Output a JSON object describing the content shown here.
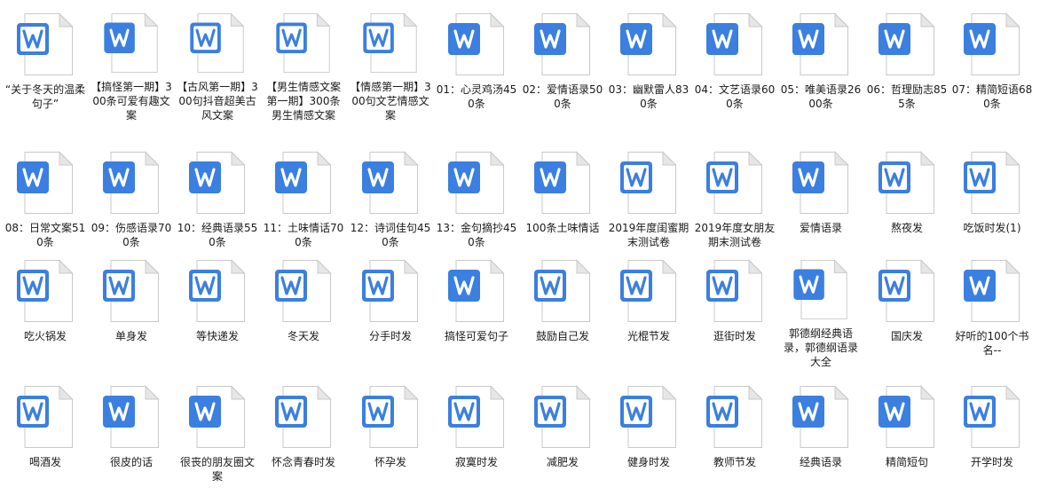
{
  "colors": {
    "word_blue": "#3B7FE0",
    "page_fill": "#FFFFFF",
    "page_border": "#C9C9C9",
    "fold_fill": "#E6E6E6",
    "label_text": "#1A1A1A"
  },
  "icons": {
    "solid": "word-document-icon",
    "outline": "word-document-outline-icon"
  },
  "rows": [
    [
      {
        "label": "“关于冬天的温柔句子”",
        "icon": "outline"
      },
      {
        "label": "【搞怪第一期】300条可爱有趣文案",
        "icon": "solid"
      },
      {
        "label": "【古风第一期】300句抖音超美古风文案",
        "icon": "outline"
      },
      {
        "label": "【男生情感文案第一期】300条男生情感文案",
        "icon": "outline"
      },
      {
        "label": "【情感第一期】300句文艺情感文案",
        "icon": "outline"
      },
      {
        "label": "01：心灵鸡汤450条",
        "icon": "solid"
      },
      {
        "label": "02：爱情语录500条",
        "icon": "solid"
      },
      {
        "label": "03：幽默雷人830条",
        "icon": "solid"
      },
      {
        "label": "04：文艺语录600条",
        "icon": "solid"
      },
      {
        "label": "05：唯美语录2600条",
        "icon": "solid"
      },
      {
        "label": "06：哲理励志855条",
        "icon": "solid"
      },
      {
        "label": "07：精简短语680条",
        "icon": "solid"
      }
    ],
    [
      {
        "label": "08：日常文案510条",
        "icon": "solid"
      },
      {
        "label": "09：伤感语录700条",
        "icon": "solid"
      },
      {
        "label": "10：经典语录550条",
        "icon": "solid"
      },
      {
        "label": "11：土味情话700条",
        "icon": "solid"
      },
      {
        "label": "12：诗词佳句450条",
        "icon": "solid"
      },
      {
        "label": "13：金句摘抄450条",
        "icon": "solid"
      },
      {
        "label": "100条土味情话",
        "icon": "solid"
      },
      {
        "label": "2019年度闺蜜期末测试卷",
        "icon": "outline"
      },
      {
        "label": "2019年度女朋友期末测试卷",
        "icon": "outline"
      },
      {
        "label": "爱情语录",
        "icon": "solid"
      },
      {
        "label": "熬夜发",
        "icon": "outline"
      },
      {
        "label": "吃饭时发(1)",
        "icon": "outline"
      }
    ],
    [
      {
        "label": "吃火锅发",
        "icon": "outline"
      },
      {
        "label": "单身发",
        "icon": "outline"
      },
      {
        "label": "等快递发",
        "icon": "outline"
      },
      {
        "label": "冬天发",
        "icon": "outline"
      },
      {
        "label": "分手时发",
        "icon": "outline"
      },
      {
        "label": "搞怪可爱句子",
        "icon": "solid"
      },
      {
        "label": "鼓励自己发",
        "icon": "outline"
      },
      {
        "label": "光棍节发",
        "icon": "outline"
      },
      {
        "label": "逛街时发",
        "icon": "outline"
      },
      {
        "label": "郭德纲经典语录，郭德纲语录大全",
        "icon": "solid"
      },
      {
        "label": "国庆发",
        "icon": "outline"
      },
      {
        "label": "好听的100个书名--",
        "icon": "solid"
      }
    ],
    [
      {
        "label": "喝酒发",
        "icon": "outline"
      },
      {
        "label": "很皮的话",
        "icon": "solid"
      },
      {
        "label": "很丧的朋友圈文案",
        "icon": "solid"
      },
      {
        "label": "怀念青春时发",
        "icon": "outline"
      },
      {
        "label": "怀孕发",
        "icon": "outline"
      },
      {
        "label": "寂寞时发",
        "icon": "outline"
      },
      {
        "label": "减肥发",
        "icon": "outline"
      },
      {
        "label": "健身时发",
        "icon": "outline"
      },
      {
        "label": "教师节发",
        "icon": "outline"
      },
      {
        "label": "经典语录",
        "icon": "solid"
      },
      {
        "label": "精简短句",
        "icon": "solid"
      },
      {
        "label": "开学时发",
        "icon": "outline"
      }
    ]
  ]
}
